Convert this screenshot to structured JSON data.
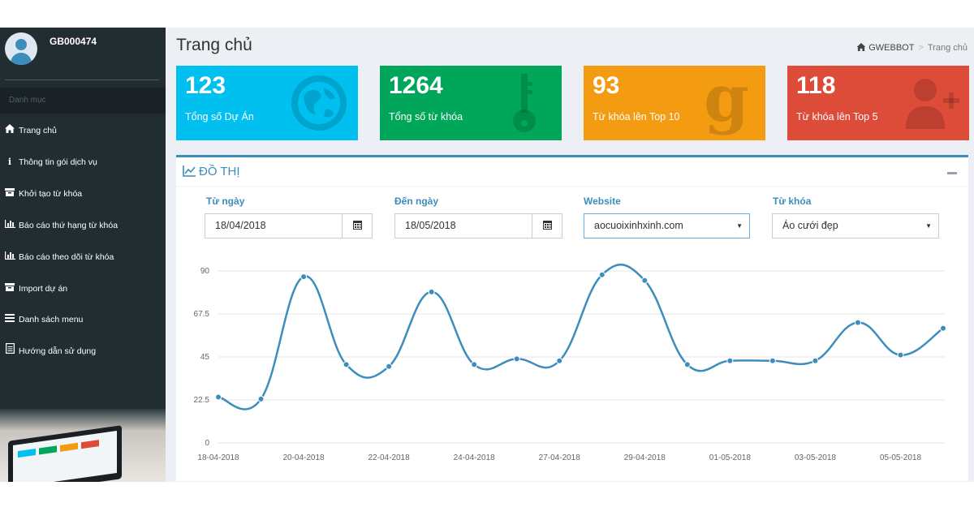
{
  "sidebar": {
    "username": "GB000474",
    "menu_header": "Danh mục",
    "items": [
      {
        "label": "Trang chủ",
        "icon": "home-icon"
      },
      {
        "label": "Thông tin gói dịch vụ",
        "icon": "info-icon"
      },
      {
        "label": "Khởi tạo từ khóa",
        "icon": "archive-icon"
      },
      {
        "label": "Báo cáo thứ hạng từ khóa",
        "icon": "bar-chart-icon"
      },
      {
        "label": "Báo cáo theo dõi từ khóa",
        "icon": "bar-chart-icon"
      },
      {
        "label": "Import dự án",
        "icon": "archive-icon"
      },
      {
        "label": "Danh sách menu",
        "icon": "list-icon"
      },
      {
        "label": "Hướng dẫn sử dụng",
        "icon": "document-icon"
      }
    ]
  },
  "header": {
    "title": "Trang chủ",
    "breadcrumb": [
      "GWEBBOT",
      "Trang chủ"
    ]
  },
  "stats": [
    {
      "value": "123",
      "label": "Tổng số Dự Án",
      "color": "#00c0ef",
      "icon": "globe-icon"
    },
    {
      "value": "1264",
      "label": "Tổng số từ khóa",
      "color": "#00a65a",
      "icon": "key-icon"
    },
    {
      "value": "93",
      "label": "Từ khóa lên Top 10",
      "color": "#f39c12",
      "icon": "google-icon"
    },
    {
      "value": "118",
      "label": "Từ khóa lên Top 5",
      "color": "#dd4b39",
      "icon": "add-user-icon"
    }
  ],
  "chart_box": {
    "title": "ĐỒ THỊ",
    "filters": {
      "from_label": "Từ ngày",
      "from_value": "18/04/2018",
      "to_label": "Đến ngày",
      "to_value": "18/05/2018",
      "website_label": "Website",
      "website_value": "aocuoixinhxinh.com",
      "keyword_label": "Từ khóa",
      "keyword_value": "Áo cưới đẹp"
    }
  },
  "chart_data": {
    "type": "line",
    "color": "#3c8dbc",
    "yticks": [
      "0",
      "22.5",
      "45",
      "67.5",
      "90"
    ],
    "ylim": [
      0,
      90
    ],
    "x": [
      "18-04-2018",
      "19-04-2018",
      "20-04-2018",
      "21-04-2018",
      "22-04-2018",
      "23-04-2018",
      "24-04-2018",
      "25-04-2018",
      "27-04-2018",
      "28-04-2018",
      "29-04-2018",
      "30-04-2018",
      "01-05-2018",
      "02-05-2018",
      "03-05-2018",
      "04-05-2018",
      "05-05-2018",
      "06-05-2018"
    ],
    "values": [
      24,
      23,
      87,
      41,
      40,
      79,
      41,
      44,
      43,
      88,
      85,
      41,
      43,
      43,
      43,
      63,
      46,
      60
    ],
    "xtick_labels": [
      "18-04-2018",
      "20-04-2018",
      "22-04-2018",
      "24-04-2018",
      "27-04-2018",
      "29-04-2018",
      "01-05-2018",
      "03-05-2018",
      "05-05-2018"
    ]
  }
}
